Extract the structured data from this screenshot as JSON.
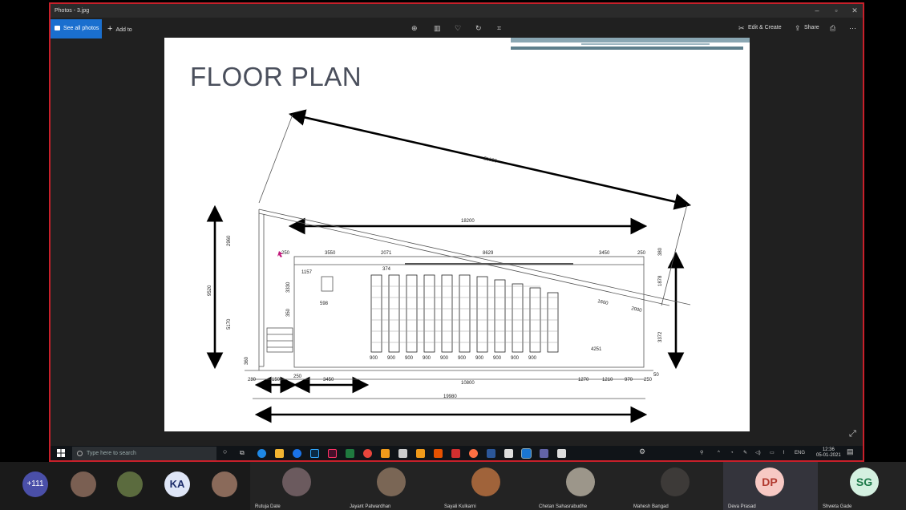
{
  "window": {
    "title": "Photos - 3.jpg",
    "minimize": "–",
    "maximize": "▫",
    "close": "✕"
  },
  "toolbar": {
    "see_all_photos": "See all photos",
    "add_to": "Add to",
    "edit_create": "Edit & Create",
    "share": "Share",
    "icons": [
      "zoom-in-icon",
      "delete-icon",
      "favorite-icon",
      "rotate-icon",
      "crop-icon"
    ]
  },
  "slide": {
    "title": "FLOOR PLAN"
  },
  "floor_plan": {
    "dims": {
      "diag": "21520",
      "top": "18200",
      "overall_bottom": "19980",
      "bottom_mid": "10800",
      "left_total": "9520",
      "left_top": "2960",
      "left_mid": "5170",
      "left_low": "360",
      "right_total": "3372",
      "right_top": "1878",
      "right_small": "380",
      "row1": [
        "250",
        "3550",
        "2071",
        "8629",
        "3450",
        "250"
      ],
      "small": [
        "1157",
        "374",
        "598",
        "3330",
        "350",
        "1600",
        "2000",
        "4251"
      ],
      "bottom": [
        "280",
        "1500",
        "250",
        "3450",
        "1270",
        "1210",
        "970",
        "250",
        "50"
      ],
      "aisle": "900"
    }
  },
  "taskbar": {
    "search_placeholder": "Type here to search",
    "lang": "ENG",
    "time": "12:36",
    "date": "05-01-2021"
  },
  "participants": {
    "overflow": "+111",
    "tiles": [
      {
        "initials": "KA",
        "name": ""
      },
      {
        "initials": "",
        "name": "Rutuja Date"
      },
      {
        "initials": "",
        "name": "Jayant Patwardhan"
      },
      {
        "initials": "",
        "name": "Sayali Kulkarni"
      },
      {
        "initials": "",
        "name": "Chetan Sahasrabudhe"
      },
      {
        "initials": "",
        "name": "Mahesh Bangad"
      },
      {
        "initials": "DP",
        "name": "Deva Prasad"
      },
      {
        "initials": "SG",
        "name": "Shweta Gade"
      }
    ],
    "colors": {
      "overflow": "#4a4fa8",
      "KA": "#dfe6f7",
      "DP": "#f7c9c4",
      "SG": "#d4f0e0"
    }
  }
}
